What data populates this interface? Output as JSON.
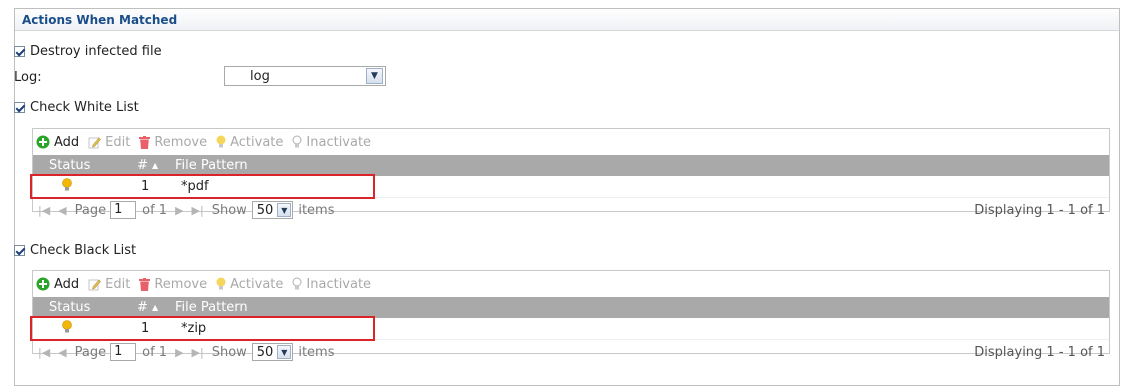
{
  "section": {
    "title": "Actions When Matched"
  },
  "destroy": {
    "label": "Destroy infected file",
    "checked": true
  },
  "log": {
    "label": "Log:",
    "value": "log"
  },
  "white_list": {
    "label": "Check White List",
    "checked": true,
    "toolbar": {
      "add": "Add",
      "edit": "Edit",
      "remove": "Remove",
      "activate": "Activate",
      "inactivate": "Inactivate"
    },
    "columns": {
      "status": "Status",
      "num": "#",
      "sort": "▲",
      "pattern": "File Pattern"
    },
    "rows": [
      {
        "status_icon": "bulb-on-icon",
        "num": "1",
        "pattern": "*pdf"
      }
    ],
    "pager": {
      "page_label": "Page",
      "page_value": "1",
      "of_label": "of 1",
      "show_label": "Show",
      "show_value": "50",
      "items_label": "items",
      "displaying": "Displaying 1 - 1 of 1"
    }
  },
  "black_list": {
    "label": "Check Black List",
    "checked": true,
    "toolbar": {
      "add": "Add",
      "edit": "Edit",
      "remove": "Remove",
      "activate": "Activate",
      "inactivate": "Inactivate"
    },
    "columns": {
      "status": "Status",
      "num": "#",
      "sort": "▲",
      "pattern": "File Pattern"
    },
    "rows": [
      {
        "status_icon": "bulb-on-icon",
        "num": "1",
        "pattern": "*zip"
      }
    ],
    "pager": {
      "page_label": "Page",
      "page_value": "1",
      "of_label": "of 1",
      "show_label": "Show",
      "show_value": "50",
      "items_label": "items",
      "displaying": "Displaying 1 - 1 of 1"
    }
  },
  "colors": {
    "title": "#1a4e8a",
    "header_bg": "#a9a9a9",
    "highlight": "#d9252a",
    "add_icon": "#2aa52a",
    "remove_icon": "#e8606a",
    "bulb_on": "#f2b705"
  }
}
